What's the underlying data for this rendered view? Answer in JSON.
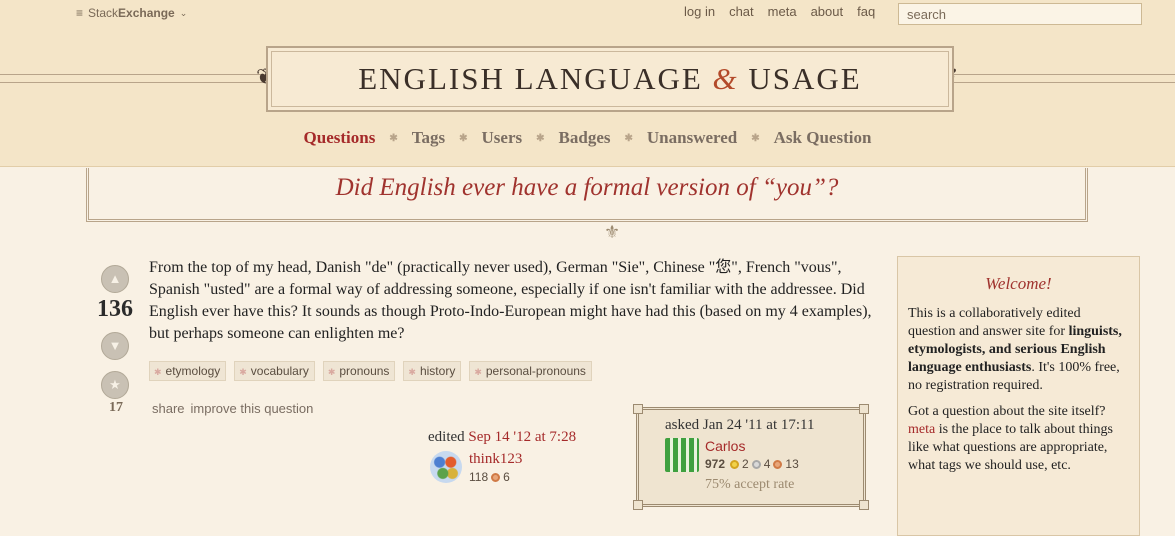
{
  "topbar": {
    "brand_prefix": "Stack",
    "brand_bold": "Exchange",
    "brand_chevron": "⌄",
    "links": [
      "log in",
      "chat",
      "meta",
      "about",
      "faq"
    ],
    "search_placeholder": "search"
  },
  "site": {
    "title_part1": "ENGLISH LANGUAGE ",
    "title_amp": "&",
    "title_part2": " USAGE"
  },
  "nav": {
    "items": [
      "Questions",
      "Tags",
      "Users",
      "Badges",
      "Unanswered",
      "Ask Question"
    ],
    "active": "Questions"
  },
  "question": {
    "title": "Did English ever have a formal version of “you”?",
    "score": "136",
    "favorites": "17",
    "body": "From the top of my head, Danish \"de\" (practically never used), German \"Sie\", Chinese \"您\", French \"vous\", Spanish \"usted\" are a formal way of addressing someone, especially if one isn't familiar with the addressee. Did English ever have this? It sounds as though Proto-Indo-European might have had this (based on my 4 examples), but perhaps someone can enlighten me?",
    "tags": [
      "etymology",
      "vocabulary",
      "pronouns",
      "history",
      "personal-pronouns"
    ],
    "menu": [
      "share",
      "improve this question"
    ]
  },
  "editor": {
    "edited_label": "edited",
    "edited_date": "Sep 14 '12 at 7:28",
    "name": "think123",
    "rep": "118",
    "bronze": "6"
  },
  "asker": {
    "asked_label": "asked Jan 24 '11 at 17:11",
    "name": "Carlos",
    "rep": "972",
    "gold": "2",
    "silver": "4",
    "bronze": "13",
    "accept_rate": "75% accept rate"
  },
  "sidebar": {
    "heading": "Welcome!",
    "p1_start": "This is a collaboratively edited question and answer site for ",
    "p1_bold": "linguists, etymologists, and serious English language enthusiasts",
    "p1_end": ". It's 100% free, no registration required.",
    "p2_start": "Got a question about the site itself? ",
    "p2_link": "meta",
    "p2_end": " is the place to talk about things like what questions are appropriate, what tags we should use, etc."
  },
  "colors": {
    "accent": "#a52a2a",
    "background": "#f9f1e4",
    "header": "#f4e5c8"
  }
}
